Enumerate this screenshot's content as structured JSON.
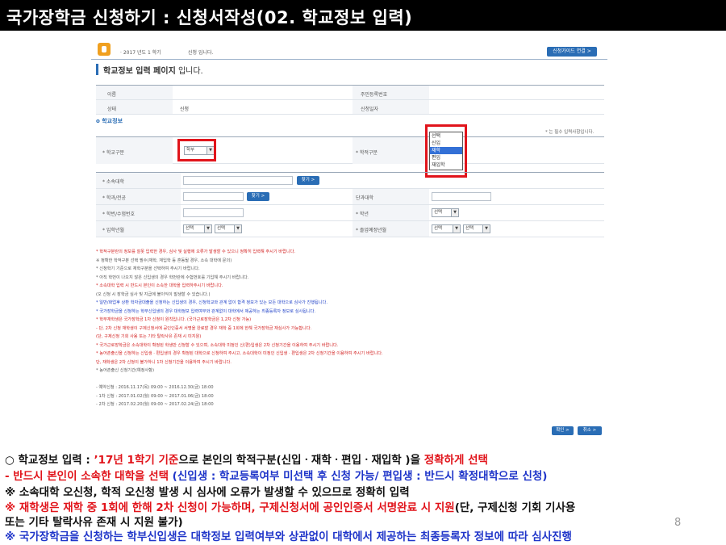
{
  "slide": {
    "title": "국가장학금 신청하기 : 신청서작성(02. 학교정보 입력)",
    "page_number": "8"
  },
  "app": {
    "year_term": "· 2017 년도 1 학기",
    "status_text": "신청 입니다.",
    "guide_button": "신청가이드 연결 >",
    "page_heading_bold": "학교정보 입력 페이지",
    "page_heading_rest": " 입니다.",
    "top_table": {
      "name_label": "이름",
      "rrn_label": "주민등록번호",
      "state_label": "상태",
      "state_value": "신청",
      "date_label": "신청일자"
    },
    "section_title": "o  학교정보",
    "required_note": "* 는 필수 입력사항입니다.",
    "school_type": {
      "label": "* 학교구분",
      "value": "학부"
    },
    "academic_status": {
      "label": "* 학적구분",
      "options": [
        "선택",
        "신입",
        "재학",
        "편입",
        "재입학"
      ],
      "highlighted": "재학"
    },
    "form": {
      "univ_label": "* 소속대학",
      "find_button": "찾기 >",
      "dept_label": "* 학과/전공",
      "find_button2": "찾기 >",
      "college_label": "단과대학",
      "student_id_label": "* 학번/수험번호",
      "grade_label": "* 학년",
      "grade_select": "선택",
      "admission_label": "* 입학년월",
      "admission_year": "선택",
      "admission_month": "선택",
      "graduation_label": "* 졸업예정년월",
      "graduation_year": "선택",
      "graduation_month": "선택"
    },
    "notes": [
      {
        "text": "* 학적구분란의 정보를 잘못 입력한 경우, 심사 및 실행에 오류가 발생할 수 있으니 정확히 입력해 주시기 바랍니다.",
        "style": "red"
      },
      {
        "text": "※ 정확한 학적구분 선택 필수(재학, 재입학 등 혼동될 경우, 소속 대학에 문의)",
        "style": "dark"
      },
      {
        "text": "* 신청학기 기준으로 재학구분을 선택하여 주시기 바랍니다.",
        "style": "dark"
      },
      {
        "text": "* 아직 학번이 나오지 않은 신입생의 경우 학번란에 수험번호를 기입해 주시기 바랍니다.",
        "style": "dark"
      },
      {
        "text": "* 소속대학 입력 시 반드시 본인이 소속한 대학을 입력하주시기 바랍니다.",
        "style": "red"
      },
      {
        "text": "(오 신청 시 장학금 심사 및 지급에 불이익이 발생할 수 있습니다.)",
        "style": "dark"
      },
      {
        "text": "* 일반/화업후 상환 학자금대출을 신청하는 신입생의 경우, 신청학교와 관계 없이 합격 정보가 있는 모든 대학으로 심사가 진행됩니다.",
        "style": "blue"
      },
      {
        "text": "* 국가장학금을 신청하는 학부신입생의 경우 대학정보 입력여부와 관계없이 대학에서 제공하는 최종등록자 정보로 심사됩니다.",
        "style": "blue"
      },
      {
        "text": "* 학부재학생은 국가장학금 1차 신청이 원칙입니다. (국가근로장학금은 1,2차 신청 가능)",
        "style": "red"
      },
      {
        "text": "- 단, 2차 신청 재학생이 구제신청서에 공인인증서 서명을 완료할 경우 재학 중 1회에 한해 국가장학금 재심사가 가능합니다.",
        "style": "red"
      },
      {
        "text": "(단, 구제신청 기회 사용 또는 기타 탈락사유 존재 시 미지원)",
        "style": "red"
      },
      {
        "text": "* 국가근로장학금은 소속대학이 확정된 학생만 신청할 수 있으며, 소속대학 미정인 신(편)입생은 2차 신청기간을 이용하여 주시기 바랍니다.",
        "style": "red"
      },
      {
        "text": "* 농어촌출신을 신청하는 신입생 · 편입생의 경우 확정된 대학으로 신청하여 주시고, 소속대학이 미정인 신입생 · 편입생은 2차 신청기간을 이용하여 주시기 바랍니다.",
        "style": "red"
      },
      {
        "text": "단, 재학생은 2차 신청이 불가하니 1차 신청기간을 이용하여 주시기 바랍니다.",
        "style": "red"
      },
      {
        "text": "* 농어촌출신 신청기간(예정사항)",
        "style": "dark"
      },
      {
        "text": "",
        "style": "dark"
      },
      {
        "text": "- 예약신청 : 2016.11.17(목) 09:00 ~ 2016.12.30(금) 18:00",
        "style": "dark"
      },
      {
        "text": "- 1차 신청 : 2017.01.02(월) 09:00 ~ 2017.01.06(금) 18:00",
        "style": "dark"
      },
      {
        "text": "- 2차 신청 : 2017.02.20(월) 09:00 ~ 2017.02.24(금) 18:00",
        "style": "dark"
      }
    ],
    "confirm_button": "확인 >",
    "cancel_button": "취소 >"
  },
  "caption": {
    "line1_a": "○ 학교정보 입력 : ",
    "line1_b": "’17년 1학기 기준",
    "line1_c": "으로 본인의 학적구분(신입ㆍ재학ㆍ편입ㆍ재입학 )을 ",
    "line1_d": "정확하게 선택",
    "line2_a": " - 반드시 본인이 소속한 대학을 선택",
    "line2_b": " (신입생 : 학교등록여부 미선택 후 신청 가능/ 편입생 : 반드시 확정대학으로 신청)",
    "line3": "    ※ 소속대학 오신청, 학적 오신청 발생 시 심사에 오류가 발생할 수 있으므로 정확히 입력",
    "line4_a": "    ※ 재학생은 재학 중 1회에 한해 2차 신청이 가능하며, 구제신청서에 공인인증서 서명완료 시 지원",
    "line4_b": "(단, 구제신청 기회 기사용",
    "line5": "       또는 기타 탈락사유 존재 시 지원 불가)",
    "line6": "    ※ 국가장학금을 신청하는 학부신입생은 대학정보 입력여부와 상관없이 대학에서 제공하는 최종등록자 정보에 따라 심사진행"
  },
  "colors": {
    "accent_blue": "#2a6db5",
    "highlight_red": "#e1141b",
    "caption_blue": "#1f35c9"
  }
}
